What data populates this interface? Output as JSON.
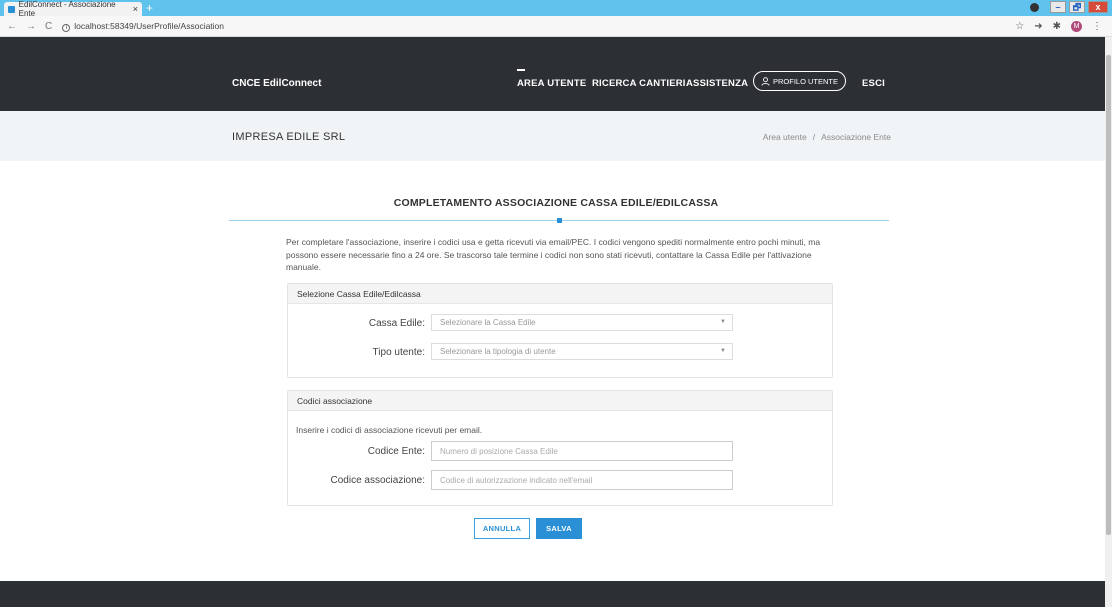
{
  "browser": {
    "tab_title": "EdilConnect - Associazione Ente",
    "tab_close": "×",
    "new_tab": "+",
    "url": "localhost:58349/UserProfile/Association",
    "nav_back": "←",
    "nav_forward": "→",
    "nav_reload": "C",
    "win_min": "–",
    "win_max": "🗗",
    "win_close": "x",
    "star": "☆",
    "avatar_initial": "M"
  },
  "navbar": {
    "brand": "CNCE EdilConnect",
    "items": [
      {
        "label": "AREA UTENTE"
      },
      {
        "label": "RICERCA CANTIERI"
      },
      {
        "label": "ASSISTENZA"
      }
    ],
    "profile_label": "PROFILO UTENTE",
    "logout_label": "ESCI"
  },
  "subheader": {
    "company": "IMPRESA EDILE SRL",
    "breadcrumb": [
      "Area utente",
      "Associazione Ente"
    ],
    "separator": "/"
  },
  "page": {
    "title": "COMPLETAMENTO ASSOCIAZIONE CASSA EDILE/EDILCASSA",
    "intro": "Per completare l'associazione, inserire i codici usa e getta ricevuti via email/PEC. I codici vengono spediti normalmente entro pochi minuti, ma possono essere necessarie fino a 24 ore. Se trascorso tale termine i codici non sono stati ricevuti, contattare la Cassa Edile per l'attivazione manuale."
  },
  "card_selection": {
    "header": "Selezione Cassa Edile/Edilcassa",
    "cassa_label": "Cassa Edile:",
    "cassa_placeholder": "Selezionare la Cassa Edile",
    "tipo_label": "Tipo utente:",
    "tipo_placeholder": "Selezionare la tipologia di utente"
  },
  "card_codes": {
    "header": "Codici associazione",
    "hint": "Inserire i codici di associazione ricevuti per email.",
    "ente_label": "Codice Ente:",
    "ente_placeholder": "Numero di posizione Cassa Edile",
    "assoc_label": "Codice associazione:",
    "assoc_placeholder": "Codice di autorizzazione indicato nell'email"
  },
  "actions": {
    "cancel": "ANNULLA",
    "save": "SALVA"
  },
  "colors": {
    "navbar_bg": "#2c2f33",
    "accent": "#2a8fd4",
    "subheader_bg": "#f0f4f6"
  }
}
